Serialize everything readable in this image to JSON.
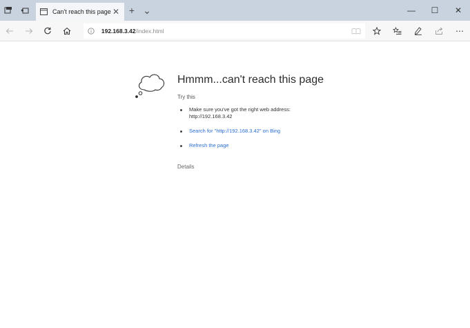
{
  "tab": {
    "title": "Can't reach this page",
    "close_glyph": "✕"
  },
  "tabbar": {
    "new_tab_glyph": "+",
    "tab_menu_glyph": "⌄"
  },
  "window_controls": {
    "minimize": "—",
    "maximize": "☐",
    "close": "✕"
  },
  "address": {
    "host": "192.168.3.42",
    "path": "/index.html"
  },
  "toolbar": {
    "more_glyph": "⋯"
  },
  "error": {
    "title": "Hmmm...can't reach this page",
    "try_this": "Try this",
    "suggestions": [
      "Make sure you've got the right web address: http://192.168.3.42",
      "Search for \"http://192.168.3.42\" on Bing",
      "Refresh the page"
    ],
    "details": "Details"
  },
  "colors": {
    "titlebar": "#c9d3df",
    "link": "#2a6fd1"
  }
}
